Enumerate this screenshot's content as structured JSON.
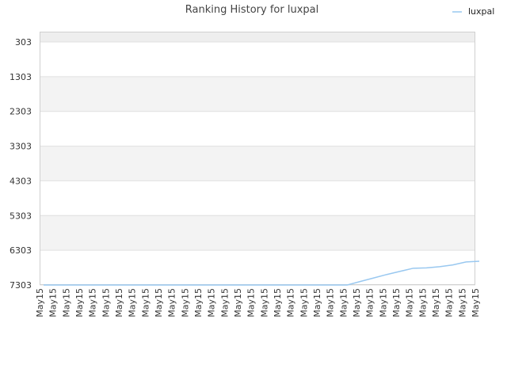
{
  "chart_data": {
    "type": "line",
    "title": "Ranking History for luxpal",
    "xlabel": "",
    "ylabel": "",
    "y_inverted": true,
    "ylim": [
      7303,
      303
    ],
    "y_ticks": [
      303,
      1303,
      2303,
      3303,
      4303,
      5303,
      6303,
      7303
    ],
    "x_tick_label": "May15",
    "x": [
      "May15",
      "May15",
      "May15",
      "May15",
      "May15",
      "May15",
      "May15",
      "May15",
      "May15",
      "May15",
      "May15",
      "May15",
      "May15",
      "May15",
      "May15",
      "May15",
      "May15",
      "May15",
      "May15",
      "May15",
      "May15",
      "May15",
      "May15",
      "May15",
      "May15",
      "May15",
      "May15",
      "May15",
      "May15",
      "May15",
      "May15",
      "May15",
      "May15",
      "May15"
    ],
    "legend_position": "top-right",
    "grid": true,
    "colors": {
      "series": "#99c8f0",
      "band": "#f3f3f3",
      "grid": "#e0e0e0",
      "axis": "#d0d0d0"
    },
    "series": [
      {
        "name": "luxpal",
        "values": [
          7303,
          7303,
          7303,
          7303,
          7303,
          7303,
          7303,
          7303,
          7303,
          7303,
          7303,
          7303,
          7303,
          7303,
          7303,
          7303,
          7303,
          7303,
          7303,
          7303,
          7303,
          7303,
          7303,
          7303,
          7200,
          7100,
          7000,
          6910,
          6820,
          6810,
          6775,
          6725,
          6640,
          6620
        ]
      }
    ]
  }
}
